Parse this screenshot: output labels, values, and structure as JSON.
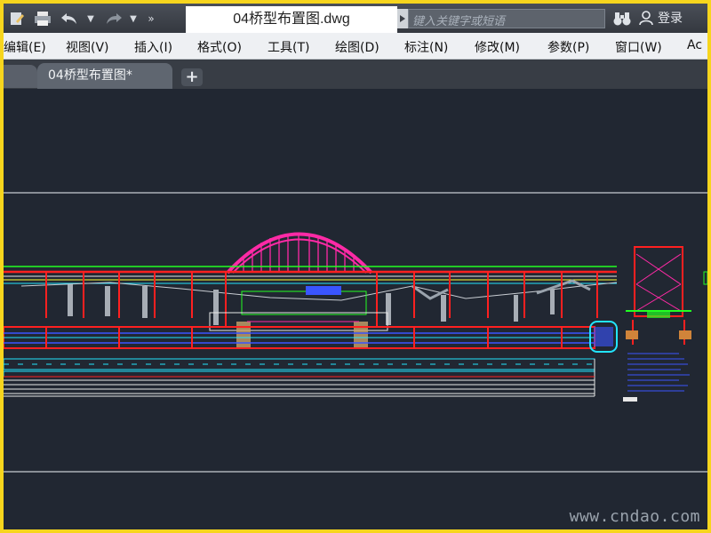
{
  "titlebar": {
    "document_title": "04桥型布置图.dwg",
    "search_placeholder": "键入关键字或短语",
    "login_label": "登录",
    "quick_access": [
      "new-icon",
      "print-icon",
      "undo-icon",
      "dropdown-icon",
      "redo-icon",
      "dropdown-icon",
      "more-icon"
    ]
  },
  "menu": {
    "items": [
      "编辑(E)",
      "视图(V)",
      "插入(I)",
      "格式(O)",
      "工具(T)",
      "绘图(D)",
      "标注(N)",
      "修改(M)",
      "参数(P)",
      "窗口(W)",
      "Ac"
    ]
  },
  "tabs": {
    "active_label": "04桥型布置图*",
    "add_label": "+"
  },
  "canvas": {
    "background": "#212732",
    "watermark": "www.cndao.com"
  },
  "colors": {
    "arch": "#ff2aa6",
    "pier_red": "#ff2020",
    "cyan": "#22e5ff",
    "green": "#22ff22",
    "blue": "#3a55ff",
    "white": "#e8e8e8",
    "yellow": "#ffff33"
  }
}
